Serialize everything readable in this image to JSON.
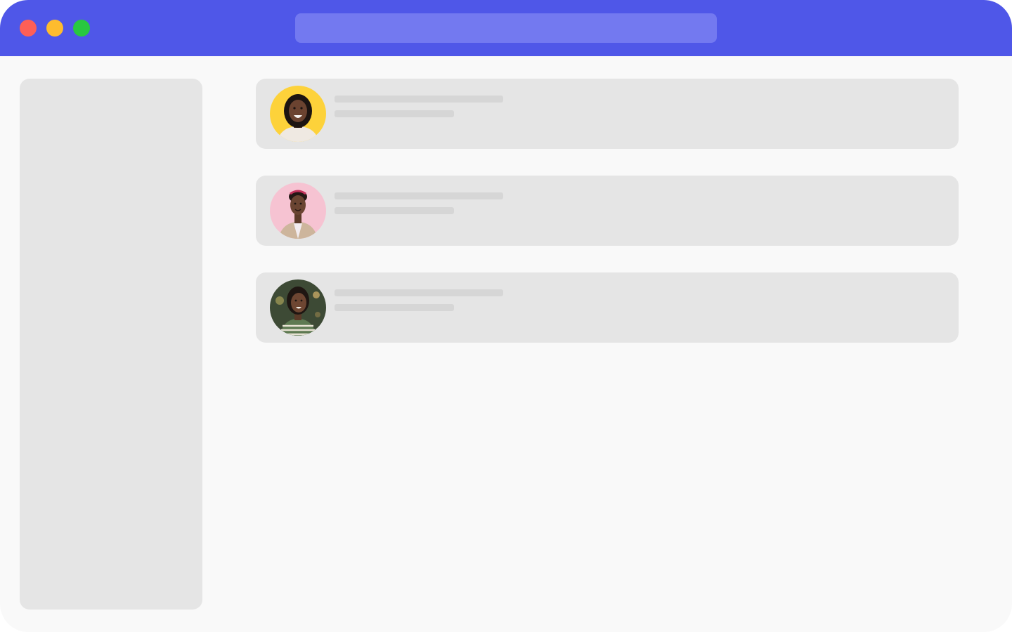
{
  "window": {
    "title_bar_color": "#4f57e8",
    "address_bar": {
      "value": ""
    },
    "traffic_lights": [
      {
        "name": "close",
        "color": "#fe5f57"
      },
      {
        "name": "minimize",
        "color": "#febc2e"
      },
      {
        "name": "zoom",
        "color": "#28c840"
      }
    ]
  },
  "sidebar": {
    "state": "placeholder"
  },
  "feed": {
    "cards": [
      {
        "avatar": "avatar-photo-yellow-background",
        "avatar_bg": "#fdd23a",
        "text_lines": "placeholder"
      },
      {
        "avatar": "avatar-photo-pink-background",
        "avatar_bg": "#f6c3d2",
        "text_lines": "placeholder"
      },
      {
        "avatar": "avatar-photo-outdoor-background",
        "avatar_bg": "#3d4a35",
        "text_lines": "placeholder"
      }
    ]
  }
}
